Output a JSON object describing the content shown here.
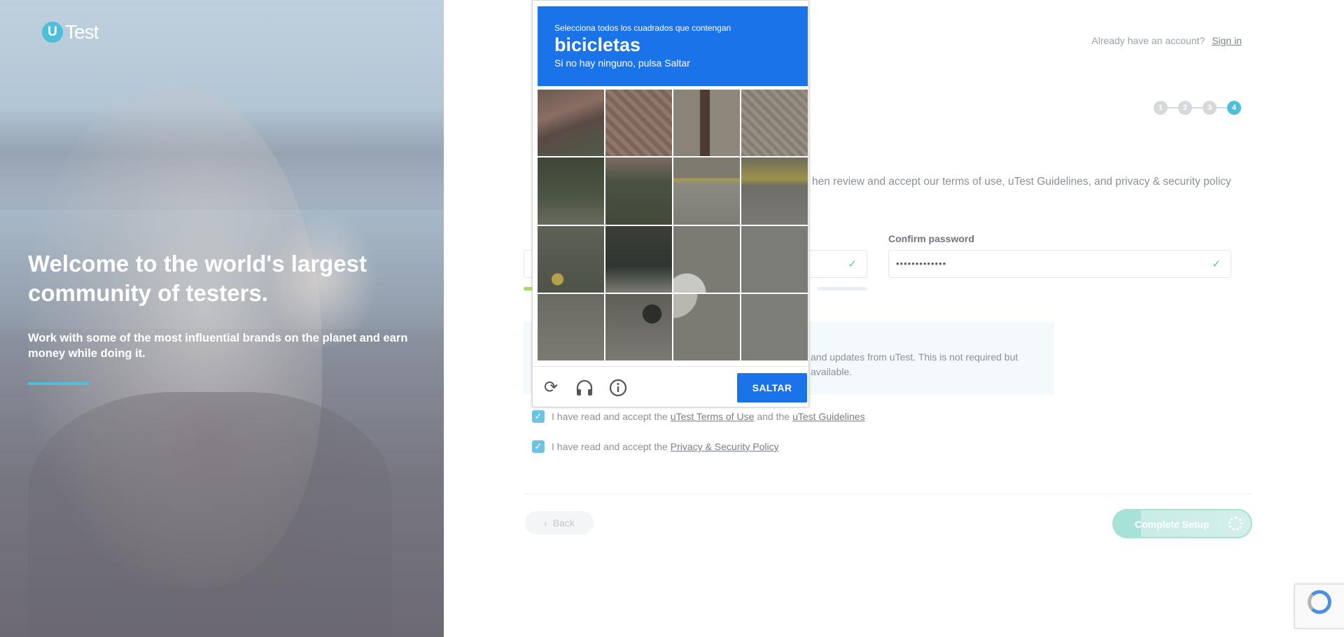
{
  "brand": {
    "logo_mark": "U",
    "logo_word": "Test",
    "accent": "#4dbfd9"
  },
  "hero": {
    "heading": "Welcome to the world's largest community of testers.",
    "subheading": "Work with some of the most influential brands on the planet and earn money while doing it."
  },
  "header": {
    "already_text": "Already have an account?",
    "sign_in": "Sign in"
  },
  "steps": [
    "1",
    "2",
    "3",
    "4"
  ],
  "active_step": "4",
  "form": {
    "intro": "hen review and accept our terms of use, uTest Guidelines, and privacy & security policy",
    "confirm_label": "Confirm password",
    "confirm_value": "•••••••••••••",
    "newsletter_text": "and updates from uTest. This is not required but available.",
    "terms_prefix": "I have read and accept the",
    "terms_link": "uTest Terms of Use",
    "terms_and": "and the",
    "guidelines_link": "uTest Guidelines",
    "privacy_prefix": "I have read and accept the",
    "privacy_link": "Privacy & Security Policy",
    "back_label": "Back",
    "complete_label": "Complete Setup"
  },
  "captcha": {
    "instruction": "Selecciona todos los cuadrados que contengan",
    "target": "bicicletas",
    "hint": "Si no hay ninguno, pulsa Saltar",
    "skip_label": "SALTAR",
    "footer_icons": [
      "reload-icon",
      "headphones-icon",
      "info-icon"
    ],
    "header_color": "#1a73e8"
  },
  "colors": {
    "checkbox": "#6ec3e3",
    "complete": "#a6e2d7"
  }
}
